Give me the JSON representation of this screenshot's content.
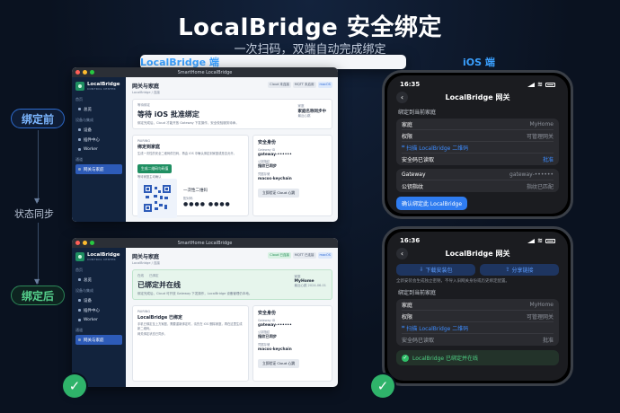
{
  "header": {
    "title": "LocalBridge 安全绑定",
    "subtitle": "一次扫码，双端自动完成绑定",
    "mac_label": "LocalBridge 端",
    "ios_label": "iOS 端"
  },
  "flow": {
    "before": "绑定前",
    "middle": "状态同步",
    "after": "绑定后"
  },
  "mac": {
    "window_title": "SmartHome LocalBridge",
    "brand_name": "LocalBridge",
    "brand_sub": "CONTROL CENTER",
    "sidebar": {
      "section_1": "首页",
      "home": "总览",
      "section_2": "设备与集成",
      "devices": "设备",
      "plugins": "插件中心",
      "worker": "Worker",
      "section_3": "通道",
      "active": "网关与家庭"
    },
    "page_title": "网关与家庭",
    "crumb": "LocalBridge / 连接",
    "chips_before": [
      "Cloud 未连接",
      "MQTT 未启用",
      "macOS"
    ],
    "chips_after": [
      "Cloud 已连接",
      "MQTT 已连接",
      "macOS"
    ],
    "before": {
      "tag": "等待绑定",
      "headline": "等待 iOS 批准绑定",
      "note": "绑定完成后，Cloud 才能开放 Gateway 下发操作，安全校验服务待命。",
      "home_k": "家庭",
      "home_v": "家庭名称同步中",
      "home_s": "最近心跳",
      "pair_tag": "PAIRING",
      "pair_title": "绑定到家庭",
      "pair_desc": "生成一次性的安全二维码供扫码，再由 iOS 中确认绑定到家庭或是否允许。",
      "pair_btn": "生成二维码与码值",
      "pair_state": "等待家庭主动确认",
      "qr_title": "一次性二维码",
      "qr_k": "配对码",
      "qr_v": "●●●● ●●●●"
    },
    "after": {
      "tag_1": "在线",
      "tag_2": "已绑定",
      "headline": "已绑定并在线",
      "note": "绑定完成后，Cloud 可开放 Gateway 下发操作，LocalBridge 设备管理仍本地。",
      "home_k": "家庭",
      "home_v": "MyHome",
      "home_s": "最近心跳 2024-06-01",
      "pair_tag": "PAIRING",
      "pair_title": "LocalBridge 已绑定",
      "pair_desc": "手机已绑定至上方家庭，需要重新绑定时，请先在 iOS 删除家庭，再在这里生成新二维码。",
      "pair_state": "网关绑定状态已同步。"
    },
    "identity": {
      "title": "安全身份",
      "gw_k": "Gateway ID",
      "gw_v": "gateway-••••••",
      "fp_k": "公钥指纹",
      "fp_v": "指纹已同步",
      "key_k": "凭据存储",
      "key_v": "macos-keychain",
      "btn": "立即验证 Cloud 心跳"
    }
  },
  "ios": {
    "p1": {
      "time": "16:35",
      "nav_title": "LocalBridge 网关",
      "section": "绑定到当前家庭",
      "rows": [
        {
          "k": "家庭",
          "v": "MyHome"
        },
        {
          "k": "权限",
          "v": "可管理网关"
        }
      ],
      "scan": "扫描 LocalBridge 二维码",
      "read_k": "安全码已读取",
      "read_v": "批准",
      "gateway_k": "Gateway",
      "gateway_v": "gateway-••••••",
      "fp_k": "公钥指纹",
      "fp_v": "指纹已匹配",
      "confirm": "确认绑定此 LocalBridge"
    },
    "p2": {
      "time": "16:36",
      "nav_title": "LocalBridge 网关",
      "btn_1": "下载安装包",
      "btn_2": "分享链接",
      "note": "全新安装会生成独立密钥，不导入旧网关身份或历史绑定配置。",
      "section": "绑定到当前家庭",
      "rows": [
        {
          "k": "家庭",
          "v": "MyHome"
        },
        {
          "k": "权限",
          "v": "可管理网关"
        }
      ],
      "scan": "扫描 LocalBridge 二维码",
      "read_k": "安全码已读取",
      "read_v": "批准",
      "success": "LocalBridge 已绑定并在线"
    }
  },
  "colors": {
    "accent": "#3aa0ff",
    "success": "#2fb36a",
    "sidebar": "#12233d"
  }
}
